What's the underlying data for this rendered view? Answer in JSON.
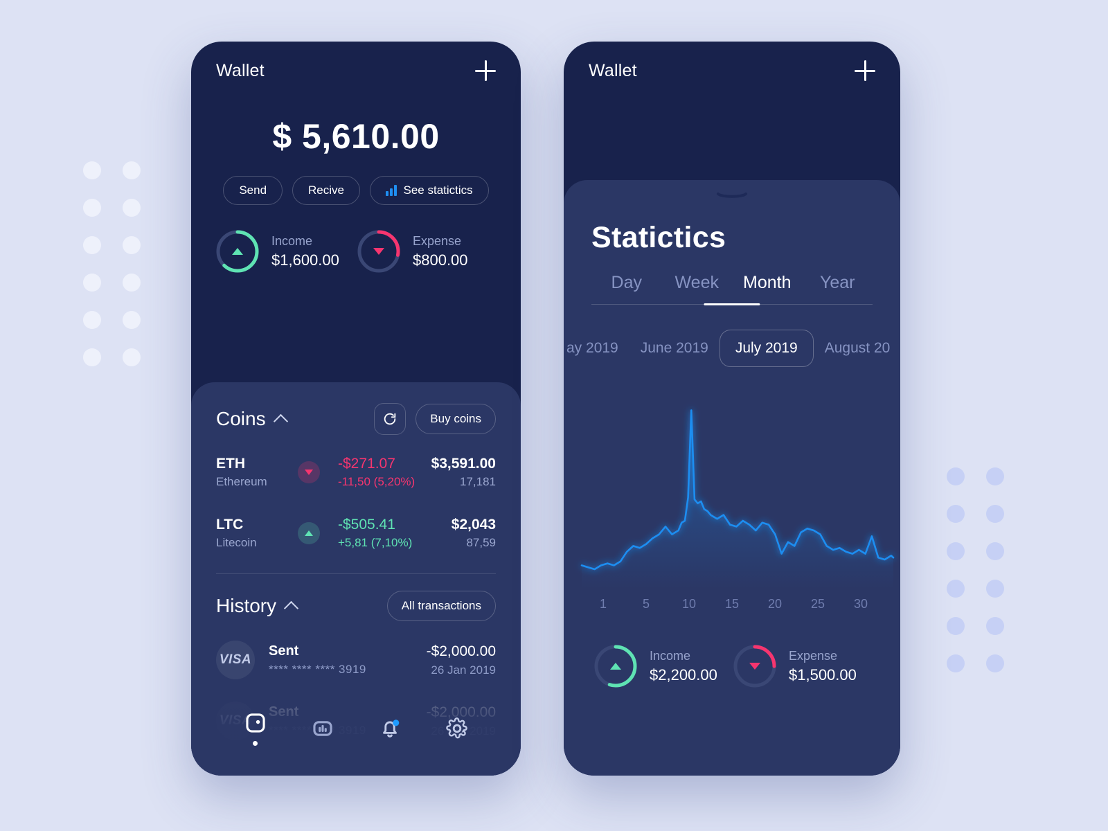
{
  "theme": {
    "page_bg": "#dde2f4",
    "phone_top_bg": "#18224c",
    "sheet_bg": "#2b3765",
    "accent_blue": "#1f8ef1",
    "positive_green": "#5fe3b3",
    "negative_pink": "#f7356f",
    "muted_text": "#98a4cd"
  },
  "left_phone": {
    "header": {
      "title": "Wallet",
      "add_icon": "plus-icon"
    },
    "balance": "$ 5,610.00",
    "actions": [
      {
        "label": "Send",
        "icon": null
      },
      {
        "label": "Recive",
        "icon": null
      },
      {
        "label": "See statictics",
        "icon": "bar-chart-icon"
      }
    ],
    "summary": [
      {
        "kind": "income",
        "label": "Income",
        "value": "$1,600.00",
        "percent": 62,
        "color": "#5fe3b3",
        "arrow": "up"
      },
      {
        "kind": "expense",
        "label": "Expense",
        "value": "$800.00",
        "percent": 28,
        "color": "#f7356f",
        "arrow": "down"
      }
    ],
    "coins_section": {
      "title": "Coins",
      "collapse_icon": "chevron-up-icon",
      "refresh_icon": "refresh-icon",
      "buy_label": "Buy coins",
      "rows": [
        {
          "symbol": "ETH",
          "name": "Ethereum",
          "trend": "down",
          "change_amount": "-$271.07",
          "change_percent": "-11,50 (5,20%)",
          "price": "$3,591.00",
          "volume": "17,181"
        },
        {
          "symbol": "LTC",
          "name": "Litecoin",
          "trend": "up",
          "change_amount": "-$505.41",
          "change_percent": "+5,81 (7,10%)",
          "price": "$2,043",
          "volume": "87,59"
        }
      ]
    },
    "history_section": {
      "title": "History",
      "collapse_icon": "chevron-up-icon",
      "all_label": "All transactions",
      "rows": [
        {
          "brand": "VISA",
          "type": "Sent",
          "card": "**** **** **** 3919",
          "amount": "-$2,000.00",
          "date": "26 Jan 2019"
        },
        {
          "brand": "VISA",
          "type": "Sent",
          "card": "**** **** **** 3919",
          "amount": "-$2,000.00",
          "date": "26 Jan 2019"
        }
      ]
    },
    "nav": [
      {
        "icon": "wallet-icon",
        "active": true,
        "badge": false
      },
      {
        "icon": "chart-icon",
        "active": false,
        "badge": false
      },
      {
        "icon": "bell-icon",
        "active": false,
        "badge": true
      },
      {
        "icon": "gear-icon",
        "active": false,
        "badge": false
      }
    ]
  },
  "right_phone": {
    "header": {
      "title": "Wallet",
      "add_icon": "plus-icon"
    },
    "grabber_icon": "sheet-grabber-icon",
    "title": "Statictics",
    "tabs": [
      {
        "label": "Day",
        "active": false
      },
      {
        "label": "Week",
        "active": false
      },
      {
        "label": "Month",
        "active": true
      },
      {
        "label": "Year",
        "active": false
      }
    ],
    "months": [
      {
        "label": "ay 2019",
        "selected": false
      },
      {
        "label": "June 2019",
        "selected": false
      },
      {
        "label": "July 2019",
        "selected": true
      },
      {
        "label": "August 20",
        "selected": false
      }
    ],
    "summary": [
      {
        "kind": "income",
        "label": "Income",
        "value": "$2,200.00",
        "percent": 55,
        "color": "#5fe3b3",
        "arrow": "up"
      },
      {
        "kind": "expense",
        "label": "Expense",
        "value": "$1,500.00",
        "percent": 25,
        "color": "#f7356f",
        "arrow": "down"
      }
    ]
  },
  "chart_data": {
    "type": "line",
    "title": "Statictics",
    "xlabel": "",
    "ylabel": "",
    "grid": false,
    "legend": null,
    "xlim": [
      1,
      30
    ],
    "ylim": [
      0,
      100
    ],
    "tick_labels": [
      "1",
      "5",
      "10",
      "15",
      "20",
      "25",
      "30"
    ],
    "line_color": "#1f8ef1",
    "area_fill": true,
    "x": [
      1,
      1.6,
      2.2,
      2.8,
      3.4,
      4,
      4.6,
      5.2,
      5.8,
      6.4,
      7,
      7.6,
      8.2,
      8.8,
      9.4,
      10,
      10.3,
      10.6,
      10.9,
      11.2,
      11.5,
      11.8,
      12.1,
      12.4,
      12.7,
      13,
      13.6,
      14.2,
      14.8,
      15.4,
      16,
      16.6,
      17.2,
      17.8,
      18.4,
      19,
      19.6,
      20.2,
      20.8,
      21.4,
      22,
      22.6,
      23.2,
      23.8,
      24.4,
      25,
      25.6,
      26.2,
      26.8,
      27.4,
      28,
      28.6,
      29.2,
      29.8,
      30
    ],
    "y": [
      12,
      11,
      10,
      12,
      13,
      12,
      14,
      19,
      22,
      21,
      23,
      26,
      28,
      32,
      28,
      30,
      34,
      35,
      47,
      92,
      46,
      44,
      45,
      41,
      40,
      38,
      36,
      38,
      33,
      32,
      35,
      33,
      30,
      34,
      33,
      28,
      18,
      24,
      22,
      29,
      31,
      30,
      28,
      22,
      20,
      21,
      19,
      18,
      20,
      18,
      27,
      16,
      15,
      17,
      16
    ]
  }
}
